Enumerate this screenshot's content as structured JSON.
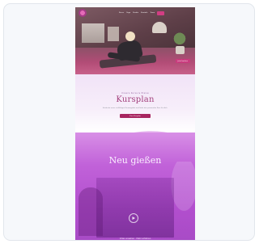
{
  "preview": {
    "nav_items": [
      "Kurse",
      "Yoga",
      "Studio",
      "Kontakt",
      "Team"
    ],
    "hero_cta": "Jetzt buchen",
    "kursplan": {
      "eyebrow": "Unsere Kurse & Preise",
      "title": "Kursplan",
      "description": "Entdecke unser vielfältiges Kursangebot und finde den passenden Kurs für dich.",
      "button": "Zum Kursplan"
    },
    "neu": {
      "title": "Neu gießen",
      "caption": "Video ansehen · Mehr erfahren"
    },
    "icons": [
      "logo-icon",
      "play-icon"
    ]
  },
  "colors": {
    "brand": "#a82560",
    "accent": "#c162d9",
    "title": "#a23f7c"
  }
}
